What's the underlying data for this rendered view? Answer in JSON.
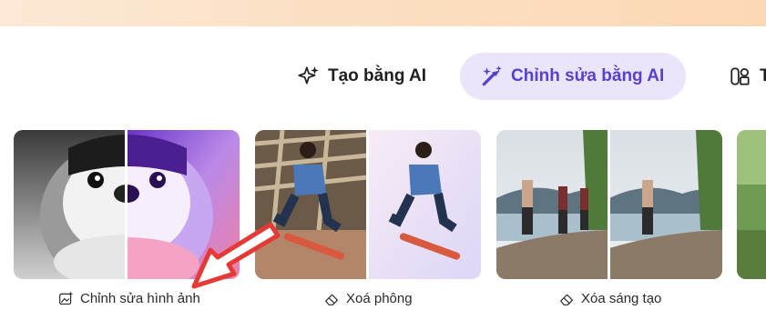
{
  "tabs": [
    {
      "label": "Tạo bằng AI",
      "icon": "sparkles-icon",
      "active": false
    },
    {
      "label": "Chỉnh sửa bằng AI",
      "icon": "magic-wand-icon",
      "active": true
    },
    {
      "label": "T",
      "icon": "shapes-icon",
      "active": false
    }
  ],
  "cards": [
    {
      "caption": "Chỉnh sửa hình ảnh",
      "icon": "image-edit-icon"
    },
    {
      "caption": "Xoá phông",
      "icon": "eraser-icon"
    },
    {
      "caption": "Xóa sáng tạo",
      "icon": "eraser-icon"
    }
  ],
  "colors": {
    "accent": "#5b3fd0",
    "active_tab_bg": "#ece4fb",
    "annotation_arrow": "#e53935"
  }
}
